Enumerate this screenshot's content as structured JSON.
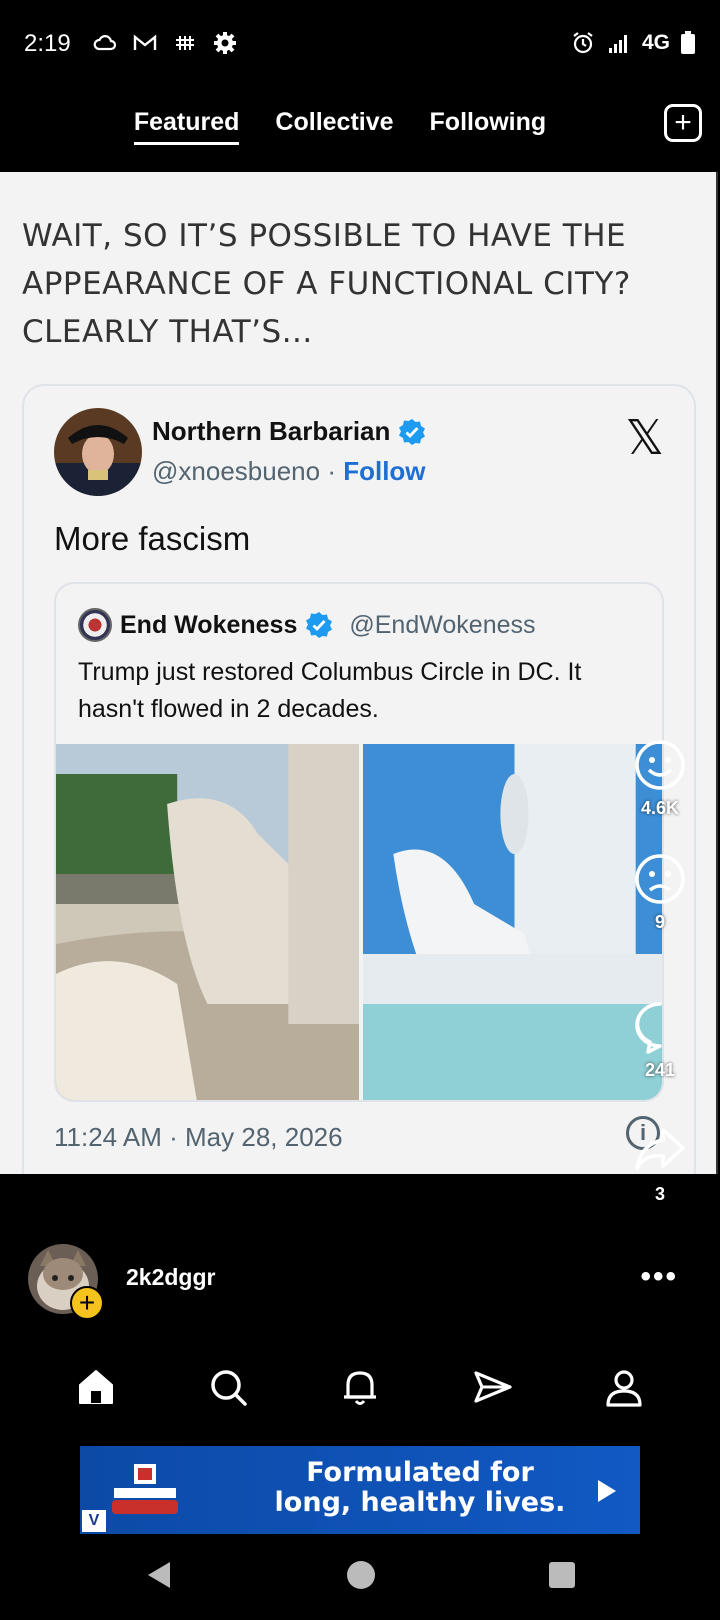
{
  "status_bar": {
    "time": "2:19",
    "left_icons": [
      "cloud-icon",
      "gmail-icon",
      "bridge-icon",
      "settings-icon"
    ],
    "right_icons": [
      "alarm-icon",
      "signal-icon",
      "battery-icon"
    ],
    "network": "4G"
  },
  "top_nav": {
    "tabs": [
      {
        "label": "Featured",
        "active": true
      },
      {
        "label": "Collective",
        "active": false
      },
      {
        "label": "Following",
        "active": false
      }
    ],
    "add_icon": "plus-square-icon"
  },
  "post": {
    "caption": "WAIT, SO IT’S POSSIBLE TO HAVE THE APPEARANCE OF A FUNCTIONAL CITY? CLEARLY THAT’S...",
    "tweet": {
      "author_name": "Northern Barbarian",
      "handle": "@xnoesbueno",
      "separator": "·",
      "follow_label": "Follow",
      "text": "More fascism",
      "timestamp": "11:24 AM · May 28, 2026",
      "info_label": "i",
      "quote": {
        "author_name": "End Wokeness",
        "handle": "@EndWokeness",
        "text": "Trump just restored Columbus Circle in DC. It hasn't flowed in 2 decades."
      }
    }
  },
  "actions": {
    "likes": "4.6K",
    "dislikes": "9",
    "comments": "241",
    "shares": "3"
  },
  "user": {
    "username": "2k2dggr",
    "plus": "+",
    "more": "•••"
  },
  "bottom_nav": [
    "home-icon",
    "search-icon",
    "bell-icon",
    "send-icon",
    "profile-icon"
  ],
  "ad": {
    "brand": "Hill's SCIENCE DIET",
    "text_line1": "Formulated for",
    "text_line2": "long, healthy lives.",
    "badge": "V"
  },
  "colors": {
    "accent_blue": "#1d6fd1",
    "verified_blue": "#1d9bf0",
    "plus_yellow": "#f6c21c"
  }
}
